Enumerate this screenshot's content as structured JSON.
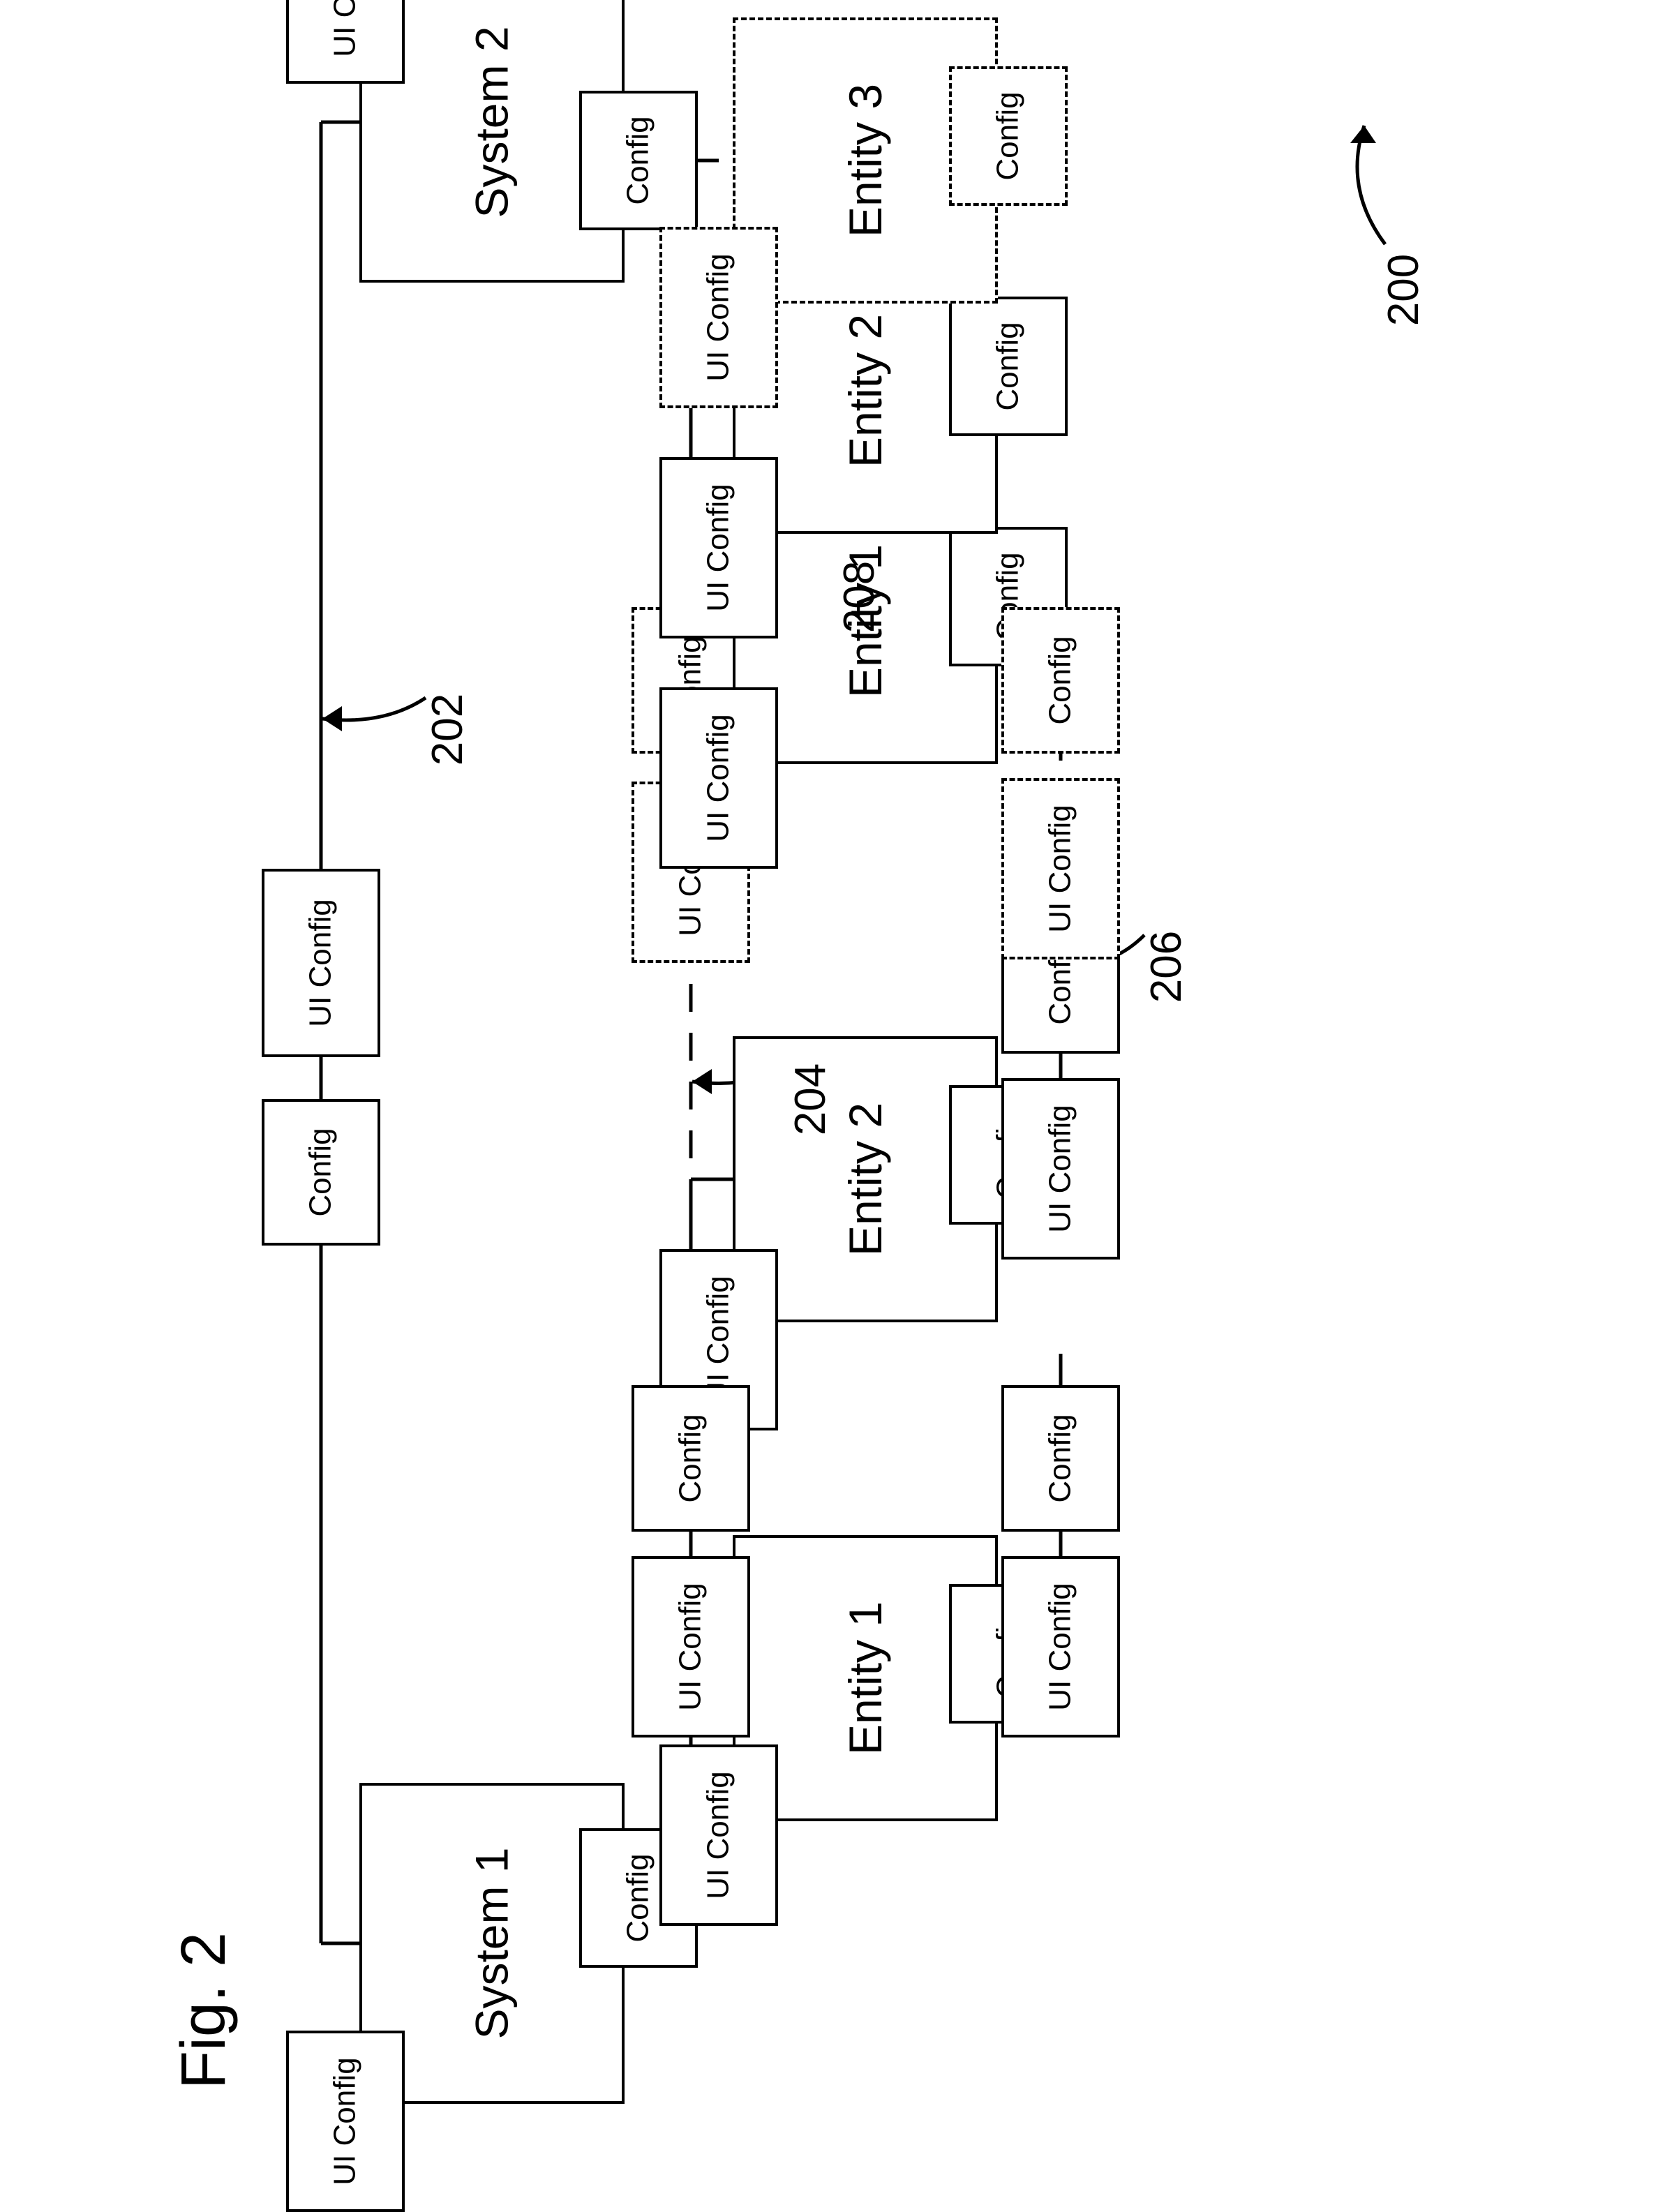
{
  "labels": {
    "ui_config": "UI Config",
    "config": "Config",
    "system1": "System 1",
    "system2": "System 2",
    "entity1": "Entity 1",
    "entity2": "Entity 2",
    "entity3": "Entity 3"
  },
  "refs": {
    "r200": "200",
    "r202": "202",
    "r204": "204",
    "r206": "206",
    "r208": "208"
  },
  "figure_caption": "Fig. 2"
}
